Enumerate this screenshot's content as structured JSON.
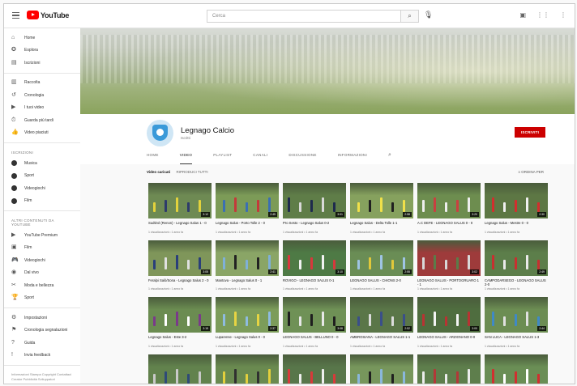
{
  "topbar": {
    "logo": "YouTube",
    "search_placeholder": "Cerca"
  },
  "sidebar": {
    "main": [
      "Home",
      "Esplora",
      "Iscrizioni"
    ],
    "library": [
      "Raccolta",
      "Cronologia",
      "I tuoi video",
      "Guarda più tardi",
      "Video piaciuti"
    ],
    "subscriptions_title": "ISCRIZIONI",
    "subscriptions": [
      "Musica",
      "Sport",
      "Videogiochi",
      "Film"
    ],
    "more_title": "ALTRI CONTENUTI DA YOUTUBE",
    "more": [
      "YouTube Premium",
      "Film",
      "Videogiochi",
      "Dal vivo",
      "Moda e bellezza",
      "Sport"
    ],
    "settings": [
      "Impostazioni",
      "Cronologia segnalazioni",
      "Guida",
      "Invia feedback"
    ],
    "footer": [
      "Informazioni Stampa Copyright Contattaci Creator Pubblicità Sviluppatori",
      "Termini Privacy Norme e sicurezza"
    ]
  },
  "channel": {
    "name": "Legnago Calcio",
    "subscribers": "Iscritti",
    "subscribe_label": "ISCRIVITI",
    "tabs": [
      "HOME",
      "VIDEO",
      "PLAYLIST",
      "CANALI",
      "DISCUSSIONE",
      "INFORMAZIONI"
    ],
    "active_tab": "VIDEO"
  },
  "content": {
    "section_title": "Video caricati",
    "section_action": "RIPRODUCI TUTTI",
    "sort_label": "ORDINA PER"
  },
  "videos": [
    {
      "title": "Sudtirol (Renon) - Legnago Salus 1 - 0",
      "meta": "1 visualizzazioni • 1 anno fa",
      "duration": "3:12",
      "palette": [
        "#6e8a53",
        "#e3d23c",
        "#2d3b6b"
      ]
    },
    {
      "title": "Legnago Salus - Porto Tolle 2 - 0",
      "meta": "1 visualizzazioni • 1 anno fa",
      "duration": "2:45",
      "palette": [
        "#7c9b57",
        "#3b6fb3",
        "#c43a3a"
      ]
    },
    {
      "title": "Pro Sesto - Legnago Salus 0-2",
      "meta": "1 visualizzazioni • 1 anno fa",
      "duration": "3:01",
      "palette": [
        "#5f7d48",
        "#1e2a4d",
        "#d9d9d9"
      ]
    },
    {
      "title": "Legnago Salus - Delta Tolle 1-1",
      "meta": "1 visualizzazioni • 1 anno fa",
      "duration": "2:58",
      "palette": [
        "#86a15e",
        "#f0e04a",
        "#202020"
      ]
    },
    {
      "title": "A.C DEFE - LEGNAGO SALUS 0 - 0",
      "meta": "1 visualizzazioni • 1 anno fa",
      "duration": "3:20",
      "palette": [
        "#6d8d4f",
        "#eeeeee",
        "#c94040"
      ]
    },
    {
      "title": "Legnago Salus - Mestre 0 - 0",
      "meta": "1 visualizzazioni • 1 anno fa",
      "duration": "2:30",
      "palette": [
        "#5d7744",
        "#d22e2e",
        "#f0f0f0"
      ]
    },
    {
      "title": "Feralpi Salò/Sona - Legnago Salus 2 - 0",
      "meta": "1 visualizzazioni • 1 anno fa",
      "duration": "3:05",
      "palette": [
        "#7f965a",
        "#2a3f7a",
        "#e0e0e0"
      ]
    },
    {
      "title": "Mantova - Legnago Salus 0 - 1",
      "meta": "1 visualizzazioni • 1 anno fa",
      "duration": "2:41",
      "palette": [
        "#8aa566",
        "#7fb0d8",
        "#222222"
      ]
    },
    {
      "title": "ROVIGO - LEGNAGO SALUS 0-1",
      "meta": "1 visualizzazioni • 1 anno fa",
      "duration": "3:10",
      "palette": [
        "#4e7a45",
        "#d8383c",
        "#f2f2f2"
      ]
    },
    {
      "title": "LEGNAGO SALUS - CHIONS 2-0",
      "meta": "1 visualizzazioni • 1 anno fa",
      "duration": "2:55",
      "palette": [
        "#6a8d55",
        "#9fc4e4",
        "#e2c83a"
      ]
    },
    {
      "title": "LEGNAGO SALUS - PORTOGRUARO 1 - 1",
      "meta": "1 visualizzazioni • 1 anno fa",
      "duration": "3:02",
      "palette": [
        "#9e3b3b",
        "#d8d8d8",
        "#5b7c49"
      ]
    },
    {
      "title": "CAMPODARSEGO - LEGNAGO SALUS 2-0",
      "meta": "1 visualizzazioni • 1 anno fa",
      "duration": "2:49",
      "palette": [
        "#5c7e4a",
        "#c83030",
        "#eaeaea"
      ]
    },
    {
      "title": "Legnago Salus - Este 3-2",
      "meta": "1 visualizzazioni • 1 anno fa",
      "duration": "3:15",
      "palette": [
        "#6b8c51",
        "#7a3a8a",
        "#ffffff"
      ]
    },
    {
      "title": "Luparense - Legnago Salus 0 - 0",
      "meta": "1 visualizzazioni • 1 anno fa",
      "duration": "2:37",
      "palette": [
        "#7c9c5a",
        "#8ebbe0",
        "#e6d443"
      ]
    },
    {
      "title": "LEGNAGO SALUS - BELLUNO 0 - 0",
      "meta": "1 visualizzazioni • 1 anno fa",
      "duration": "3:08",
      "palette": [
        "#6f9156",
        "#1f1f1f",
        "#e8e8e8"
      ]
    },
    {
      "title": "AMBROSIANA - LEGNAGO SALUS 1-1",
      "meta": "1 visualizzazioni • 1 anno fa",
      "duration": "2:52",
      "palette": [
        "#5a7648",
        "#3a4f8a",
        "#dcdcdc"
      ]
    },
    {
      "title": "LEGNAGO SALUS - ARZIGNANO 0-0",
      "meta": "1 visualizzazioni • 1 anno fa",
      "duration": "3:00",
      "palette": [
        "#4f6d3f",
        "#b83333",
        "#f4f4f4"
      ]
    },
    {
      "title": "SAN LUCA - LEGNAGO SALUS 1-3",
      "meta": "1 visualizzazioni • 1 anno fa",
      "duration": "2:44",
      "palette": [
        "#6c8d53",
        "#3f89c7",
        "#e0e0e0"
      ]
    },
    {
      "title": "",
      "meta": "",
      "duration": "",
      "palette": [
        "#62824d",
        "#c9c9c9",
        "#2e4a78"
      ]
    },
    {
      "title": "",
      "meta": "",
      "duration": "",
      "palette": [
        "#6a8a50",
        "#e3cf3d",
        "#303030"
      ]
    },
    {
      "title": "",
      "meta": "",
      "duration": "",
      "palette": [
        "#58764a",
        "#d83a3a",
        "#efefef"
      ]
    },
    {
      "title": "",
      "meta": "",
      "duration": "",
      "palette": [
        "#77965c",
        "#8ab7dc",
        "#1f1f1f"
      ]
    },
    {
      "title": "",
      "meta": "",
      "duration": "",
      "palette": [
        "#5e7e4c",
        "#ececec",
        "#b23838"
      ]
    },
    {
      "title": "",
      "meta": "",
      "duration": "",
      "palette": [
        "#6a8e55",
        "#d12f2f",
        "#ffffff"
      ]
    }
  ],
  "colors": {
    "accent": "#cc0000",
    "sidebar_bg": "#ffffff",
    "page_bg": "#f9f9f9"
  }
}
